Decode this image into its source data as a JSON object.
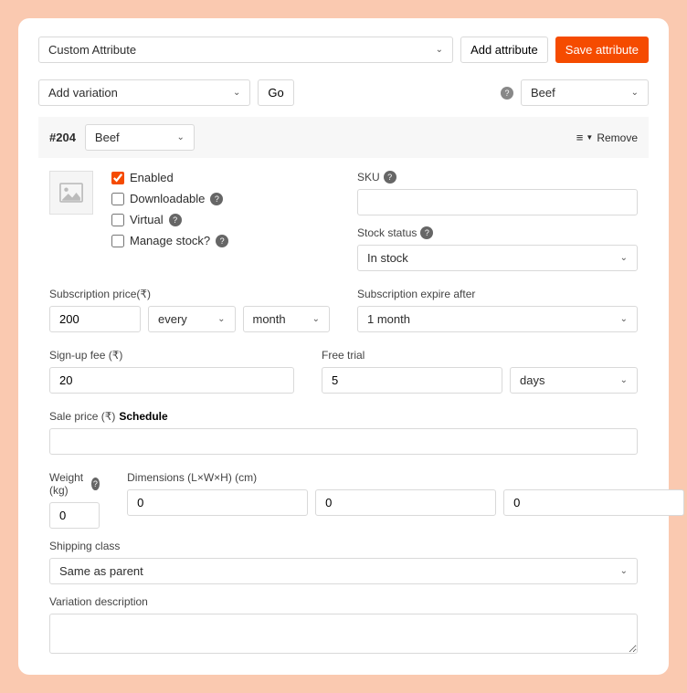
{
  "attributeRow": {
    "customAttribute": "Custom Attribute",
    "addAttribute": "Add attribute",
    "saveAttribute": "Save attribute"
  },
  "variationTop": {
    "addVariation": "Add variation",
    "go": "Go",
    "defaultSelect": "Beef"
  },
  "variation": {
    "id": "#204",
    "attrValue": "Beef",
    "remove": "Remove"
  },
  "checkboxes": {
    "enabled": "Enabled",
    "downloadable": "Downloadable",
    "virtual": "Virtual",
    "manageStock": "Manage stock?"
  },
  "skuLabel": "SKU",
  "stockStatusLabel": "Stock status",
  "stockStatusValue": "In stock",
  "subPriceLabel": "Subscription price(₹)",
  "subPriceValue": "200",
  "subEvery": "every",
  "subPeriod": "month",
  "subExpireLabel": "Subscription expire after",
  "subExpireValue": "1 month",
  "signupFeeLabel": "Sign-up fee (₹)",
  "signupFeeValue": "20",
  "freeTrialLabel": "Free trial",
  "freeTrialValue": "5",
  "freeTrialUnit": "days",
  "salePriceLabel": "Sale price (₹)",
  "scheduleLink": "Schedule",
  "weightLabel": "Weight (kg)",
  "weightValue": "0",
  "dimensionsLabel": "Dimensions (L×W×H) (cm)",
  "dimL": "0",
  "dimW": "0",
  "dimH": "0",
  "shippingClassLabel": "Shipping class",
  "shippingClassValue": "Same as parent",
  "descriptionLabel": "Variation description"
}
